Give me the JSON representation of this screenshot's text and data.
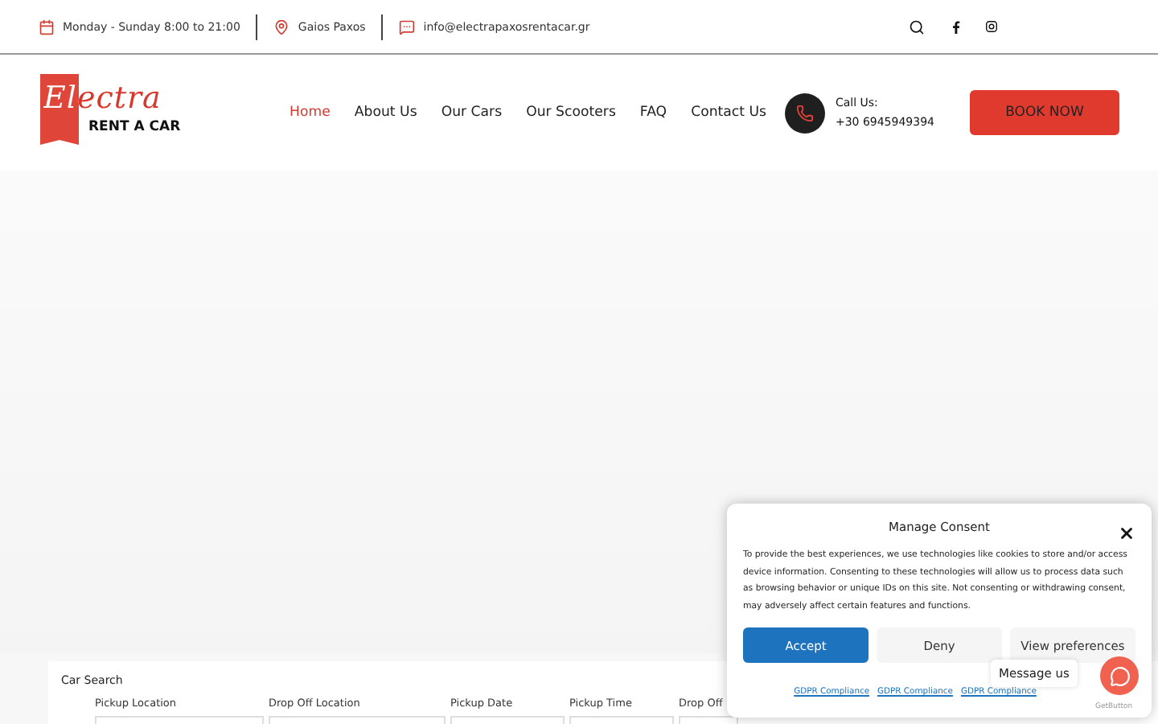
{
  "topbar": {
    "hours": "Monday - Sunday 8:00 to 21:00",
    "location": "Gaios Paxos",
    "email": "info@electrapaxosrentacar.gr"
  },
  "logo": {
    "script": "Electra",
    "tagline": "RENT A CAR"
  },
  "nav": [
    {
      "label": "Home",
      "selected": true
    },
    {
      "label": "About Us",
      "selected": false
    },
    {
      "label": "Our Cars",
      "selected": false
    },
    {
      "label": "Our Scooters",
      "selected": false
    },
    {
      "label": "FAQ",
      "selected": false
    },
    {
      "label": "Contact Us",
      "selected": false
    }
  ],
  "call": {
    "label": "Call Us:",
    "phone": "+30 6945949394"
  },
  "book_button": "BOOK NOW",
  "car_search": {
    "title": "Car Search",
    "fields": [
      "Pickup Location",
      "Drop Off Location",
      "Pickup Date",
      "Pickup Time",
      "Drop Off"
    ]
  },
  "consent": {
    "title": "Manage Consent",
    "text": "To provide the best experiences, we use technologies like cookies to store and/or access device information. Consenting to these technologies will allow us to process data such as browsing behavior or unique IDs on this site. Not consenting or withdrawing consent, may adversely affect certain features and functions.",
    "buttons": [
      {
        "label": "Accept",
        "kind": "primary"
      },
      {
        "label": "Deny",
        "kind": "secondary"
      },
      {
        "label": "View preferences",
        "kind": "secondary"
      }
    ],
    "links": [
      "GDPR Compliance",
      "GDPR Compliance",
      "GDPR Compliance"
    ]
  },
  "chat": {
    "bubble": "Message us",
    "credit": "GetButton"
  }
}
